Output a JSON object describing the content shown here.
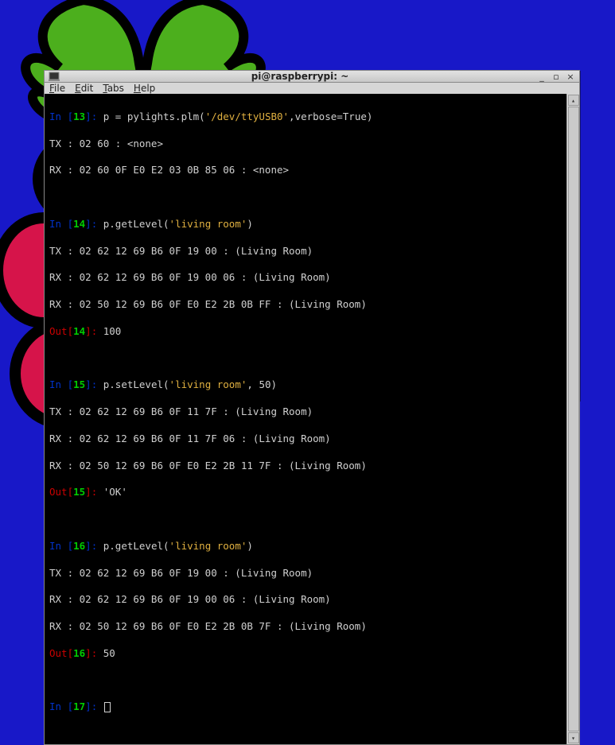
{
  "window": {
    "title": "pi@raspberrypi: ~",
    "menu": {
      "file": "File",
      "edit": "Edit",
      "tabs": "Tabs",
      "help": "Help"
    }
  },
  "term": {
    "in13_prefix": "In [",
    "in13_num": "13",
    "in13_suffix": "]: ",
    "in13_code_a": "p = pylights.plm(",
    "in13_str": "'/dev/ttyUSB0'",
    "in13_code_b": ",verbose=True)",
    "l13_tx": "TX : 02 60 : <none>",
    "l13_rx": "RX : 02 60 0F E0 E2 03 0B 85 06 : <none>",
    "in14_num": "14",
    "in14_code_a": "p.getLevel(",
    "in14_str": "'living room'",
    "in14_code_b": ")",
    "l14_tx": "TX : 02 62 12 69 B6 0F 19 00 : (Living Room)",
    "l14_rx1": "RX : 02 62 12 69 B6 0F 19 00 06 : (Living Room)",
    "l14_rx2": "RX : 02 50 12 69 B6 0F E0 E2 2B 0B FF : (Living Room)",
    "out14_prefix": "Out[",
    "out14_num": "14",
    "out14_suffix": "]: ",
    "out14_val": "100",
    "in15_num": "15",
    "in15_code_a": "p.setLevel(",
    "in15_str": "'living room'",
    "in15_code_b": ", 50)",
    "l15_tx": "TX : 02 62 12 69 B6 0F 11 7F : (Living Room)",
    "l15_rx1": "RX : 02 62 12 69 B6 0F 11 7F 06 : (Living Room)",
    "l15_rx2": "RX : 02 50 12 69 B6 0F E0 E2 2B 11 7F : (Living Room)",
    "out15_num": "15",
    "out15_val": "'OK'",
    "in16_num": "16",
    "in16_code_a": "p.getLevel(",
    "in16_str": "'living room'",
    "in16_code_b": ")",
    "l16_tx": "TX : 02 62 12 69 B6 0F 19 00 : (Living Room)",
    "l16_rx1": "RX : 02 62 12 69 B6 0F 19 00 06 : (Living Room)",
    "l16_rx2": "RX : 02 50 12 69 B6 0F E0 E2 2B 0B 7F : (Living Room)",
    "out16_num": "16",
    "out16_val": "50",
    "in17_num": "17"
  }
}
